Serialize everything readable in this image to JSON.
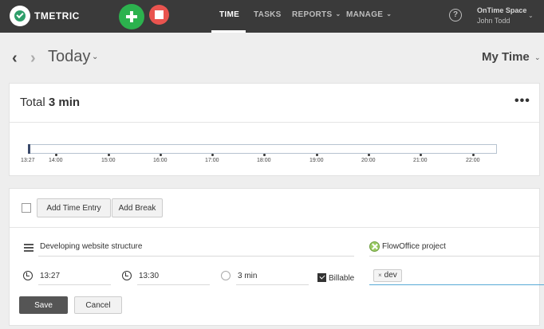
{
  "header": {
    "brand": "TMETRIC",
    "nav": [
      {
        "label": "TIME",
        "active": true
      },
      {
        "label": "TASKS",
        "active": false
      },
      {
        "label": "REPORTS",
        "active": false
      },
      {
        "label": "MANAGE",
        "active": false
      }
    ],
    "workspace_name": "OnTime Space",
    "user_name": "John Todd",
    "help_symbol": "?"
  },
  "date_bar": {
    "title": "Today",
    "view": "My Time"
  },
  "summary": {
    "total_label": "Total",
    "total_value": "3 min",
    "timeline_ticks": [
      "13:27",
      "14:00",
      "15:00",
      "16:00",
      "17:00",
      "18:00",
      "19:00",
      "20:00",
      "21:00",
      "22:00"
    ]
  },
  "entry_toolbar": {
    "add_time_entry": "Add Time Entry",
    "add_break": "Add Break"
  },
  "entry": {
    "description": "Developing website structure",
    "project": "FlowOffice project",
    "start_time": "13:27",
    "end_time": "13:30",
    "duration": "3 min",
    "billable_label": "Billable",
    "billable": true,
    "tags": [
      "dev"
    ],
    "save_label": "Save",
    "cancel_label": "Cancel"
  },
  "colors": {
    "topbar": "#3a3a3a",
    "start_button": "#2cb24e",
    "stop_button": "#e9544f",
    "brand_logo": "#2e9e6a",
    "project_icon": "#9acb63",
    "focus_line": "#57a9d6"
  }
}
